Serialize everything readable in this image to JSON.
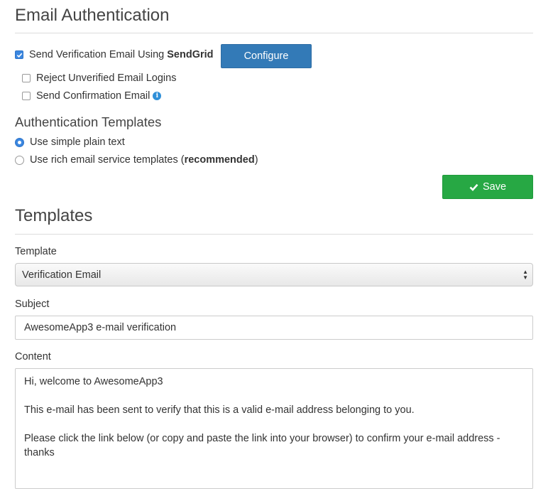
{
  "email_auth": {
    "title": "Email Authentication",
    "send_verification": {
      "checked": true,
      "label": "Send Verification Email Using ",
      "provider": "SendGrid"
    },
    "configure_label": "Configure",
    "reject_unverified": {
      "checked": false,
      "label": "Reject Unverified Email Logins"
    },
    "send_confirmation": {
      "checked": false,
      "label": "Send Confirmation Email",
      "icon": "info-icon"
    }
  },
  "auth_templates": {
    "title": "Authentication Templates",
    "options": [
      {
        "label": "Use simple plain text",
        "selected": true
      },
      {
        "label_prefix": "Use rich email service templates (",
        "label_bold": "recommended",
        "label_suffix": ")",
        "selected": false
      }
    ],
    "save_label": "Save"
  },
  "templates": {
    "title": "Templates",
    "template_label": "Template",
    "template_value": "Verification Email",
    "subject_label": "Subject",
    "subject_value": "AwesomeApp3 e-mail verification",
    "content_label": "Content",
    "content_lines": [
      "Hi, welcome to AwesomeApp3",
      "This e-mail has been sent to verify that this is a valid e-mail address belonging to you.",
      "Please click the link below (or copy and paste the link into your browser) to confirm your e-mail address - thanks"
    ]
  },
  "colors": {
    "primary_button": "#337ab7",
    "save_button": "#27a844",
    "checkbox_checked": "#3b87e0"
  }
}
